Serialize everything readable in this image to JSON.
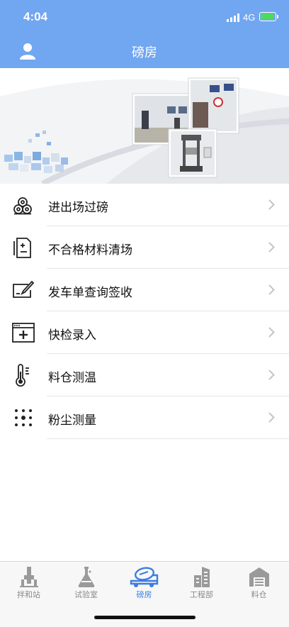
{
  "status": {
    "time": "4:04",
    "network": "4G"
  },
  "header": {
    "title": "磅房"
  },
  "menu": [
    {
      "label": "进出场过磅",
      "icon": "weighing-rolls-icon"
    },
    {
      "label": "不合格材料清场",
      "icon": "document-clear-icon"
    },
    {
      "label": "发车单查询签收",
      "icon": "sign-edit-icon"
    },
    {
      "label": "快检录入",
      "icon": "quick-entry-icon"
    },
    {
      "label": "料仓测温",
      "icon": "thermometer-icon"
    },
    {
      "label": "粉尘测量",
      "icon": "dust-dots-icon"
    }
  ],
  "tabs": [
    {
      "label": "拌和站",
      "icon": "mixing-plant-icon",
      "active": false
    },
    {
      "label": "试验室",
      "icon": "lab-flask-icon",
      "active": false
    },
    {
      "label": "磅房",
      "icon": "mixer-truck-icon",
      "active": true
    },
    {
      "label": "工程部",
      "icon": "building-icon",
      "active": false
    },
    {
      "label": "料仓",
      "icon": "warehouse-icon",
      "active": false
    }
  ],
  "colors": {
    "header": "#71A6F0",
    "active_tab": "#3d7de0",
    "inactive_tab": "#8a8a8a"
  }
}
